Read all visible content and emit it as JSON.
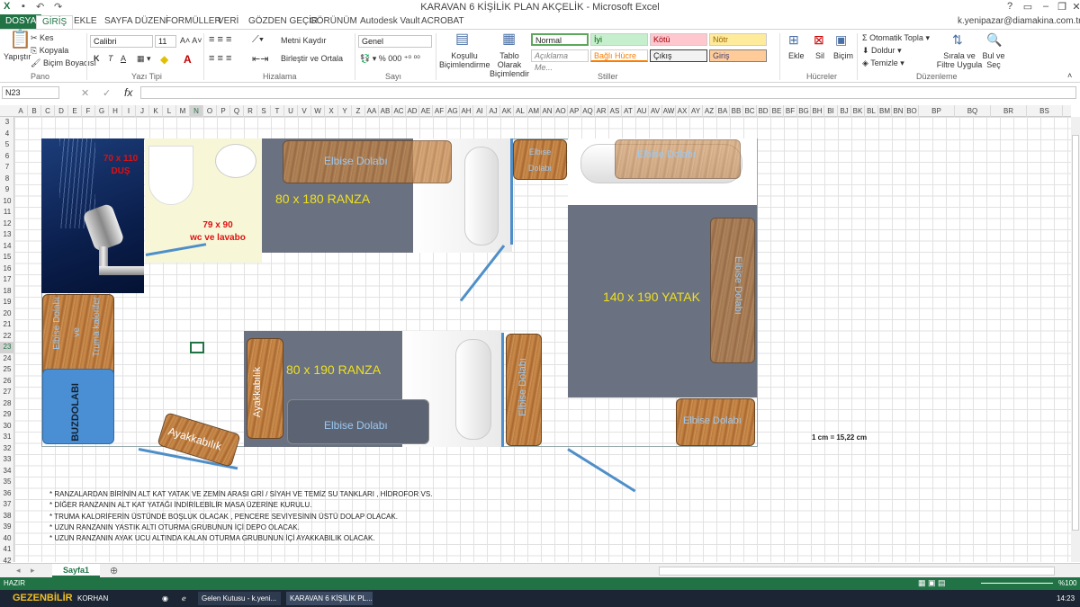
{
  "window": {
    "title": "KARAVAN 6 KİŞİLİK PLAN AKÇELİK - Microsoft Excel",
    "user": "k.yenipazar@diamakina.com.tr"
  },
  "tabs": [
    "DOSYA",
    "GİRİŞ",
    "EKLE",
    "SAYFA DÜZENİ",
    "FORMÜLLER",
    "VERİ",
    "GÖZDEN GEÇİR",
    "GÖRÜNÜM",
    "Autodesk Vault",
    "ACROBAT"
  ],
  "ribbon": {
    "clipboard": {
      "paste": "Yapıştır",
      "cut": "Kes",
      "copy": "Kopyala",
      "format_painter": "Biçim Boyacısı",
      "label": "Pano"
    },
    "font": {
      "name": "Calibri",
      "size": "11",
      "bold": "K",
      "italic": "T",
      "underline": "A",
      "label": "Yazı Tipi"
    },
    "alignment": {
      "wrap": "Metni Kaydır",
      "merge": "Birleştir ve Ortala",
      "label": "Hizalama"
    },
    "number": {
      "format": "Genel",
      "label": "Sayı"
    },
    "styles": {
      "conditional": "Koşullu Biçimlendirme",
      "table": "Tablo Olarak Biçimlendir",
      "cells": [
        "Normal",
        "İyi",
        "Kötü",
        "Nötr",
        "Açıklama Me...",
        "Bağlı Hücre",
        "Çıkış",
        "Giriş"
      ],
      "label": "Stiller"
    },
    "cells": {
      "insert": "Ekle",
      "delete": "Sil",
      "format": "Biçim",
      "label": "Hücreler"
    },
    "editing": {
      "autosum": "Otomatik Topla",
      "fill": "Doldur",
      "clear": "Temizle",
      "sort": "Sırala ve Filtre Uygula",
      "find": "Bul ve Seç",
      "label": "Düzenleme"
    }
  },
  "formula_bar": {
    "name_box": "N23",
    "fx": "fx",
    "value": ""
  },
  "columns": [
    "A",
    "B",
    "C",
    "D",
    "E",
    "F",
    "G",
    "H",
    "I",
    "J",
    "K",
    "L",
    "M",
    "N",
    "O",
    "P",
    "Q",
    "R",
    "S",
    "T",
    "U",
    "V",
    "W",
    "X",
    "Y",
    "Z",
    "AA",
    "AB",
    "AC",
    "AD",
    "AE",
    "AF",
    "AG",
    "AH",
    "AI",
    "AJ",
    "AK",
    "AL",
    "AM",
    "AN",
    "AO",
    "AP",
    "AQ",
    "AR",
    "AS",
    "AT",
    "AU",
    "AV",
    "AW",
    "AX",
    "AY",
    "AZ",
    "BA",
    "BB",
    "BC",
    "BD",
    "BE",
    "BF",
    "BG",
    "BH",
    "BI",
    "BJ",
    "BK",
    "BL",
    "BM",
    "BN",
    "BO",
    "BP",
    "BQ",
    "BR",
    "BS"
  ],
  "rows": [
    "3",
    "4",
    "5",
    "6",
    "7",
    "8",
    "9",
    "10",
    "11",
    "12",
    "13",
    "14",
    "15",
    "16",
    "17",
    "18",
    "19",
    "20",
    "21",
    "22",
    "23",
    "24",
    "25",
    "26",
    "27",
    "28",
    "29",
    "30",
    "31",
    "32",
    "33",
    "34",
    "35",
    "36",
    "37",
    "38",
    "39",
    "40",
    "41",
    "42"
  ],
  "plan": {
    "shower": [
      "70 x 110",
      "DUŞ"
    ],
    "wc": [
      "79 x 90",
      "wc ve lavabo"
    ],
    "bunk_top": "80 x 180 RANZA",
    "bunk_bottom": "80 x 190 RANZA",
    "bed": "140 x 190 YATAK",
    "wardrobe": "Elbise Dolabı",
    "wardrobe_small": [
      "Elbise",
      "Dolabı"
    ],
    "wardrobe_heater": [
      "Elbise Dolabı",
      "ve",
      "Truma kalorifer"
    ],
    "fridge": "BUZDOLABI",
    "shoe": "Ayakkabılık",
    "scale": "1 cm = 15,22 cm"
  },
  "notes": [
    "*  RANZALARDAN BİRİNİN ALT KAT YATAK VE  ZEMİN ARASI GRİ / SİYAH VE TEMİZ SU TANKLARI , HİDROFOR VS.",
    "*  DİĞER RANZANIN ALT KAT YATAĞI İNDİRİLEBİLİR MASA ÜZERİNE KURULU.",
    "*  TRUMA KALORİFERİN ÜSTÜNDE BOŞLUK OLACAK , PENCERE SEVİYESİNİN ÜSTÜ DOLAP OLACAK.",
    "*  UZUN RANZANIN YASTIK ALTI OTURMA GRUBUNUN İÇİ DEPO OLACAK.",
    "*  UZUN RANZANIN AYAK UCU ALTINDA KALAN OTURMA GRUBUNUN İÇİ AYAKKABILIK OLACAK."
  ],
  "sheet": {
    "tab": "Sayfa1",
    "ready": "HAZIR",
    "zoom": "%100"
  },
  "taskbar": {
    "brand": "GEZENBİLİR",
    "items": [
      "KORHAN",
      "Gelen Kutusu - k.yeni...",
      "KARAVAN 6 KİŞİLİK PL..."
    ],
    "time": "14:23"
  },
  "colors": {
    "excel_green": "#217346",
    "wall": "#4f8fc9",
    "bed": "#6a7180"
  }
}
